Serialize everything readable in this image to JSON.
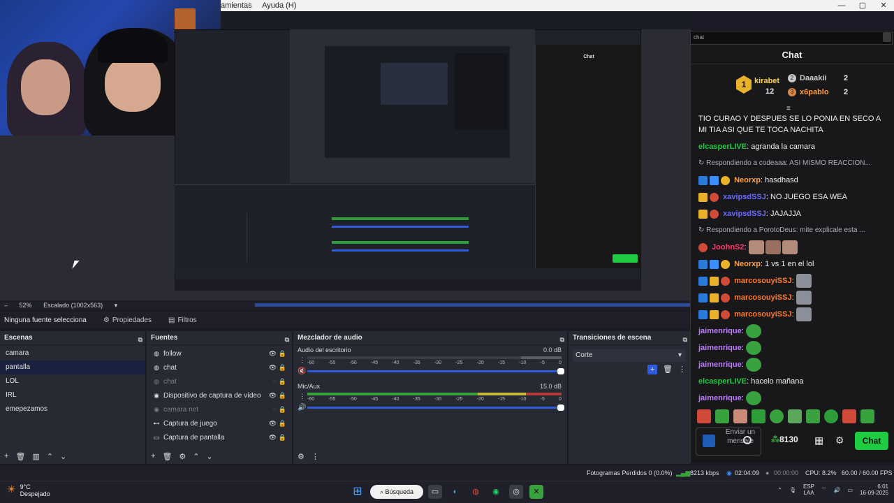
{
  "app": {
    "menu": [
      "amientas",
      "Ayuda (H)"
    ],
    "window_controls": [
      "—",
      "▢",
      "✕"
    ]
  },
  "preview": {
    "zoom": "52%",
    "scale": "Escalado (1002x563)"
  },
  "source_bar": {
    "selected_text": "Ninguna fuente selecciona",
    "properties_label": "Propiedades",
    "filters_label": "Filtros"
  },
  "scenes": {
    "title": "Escenas",
    "items": [
      "camara",
      "pantalla",
      "LOL",
      "IRL",
      "emepezamos"
    ],
    "selected_index": 1
  },
  "sources": {
    "title": "Fuentes",
    "items": [
      {
        "name": "follow",
        "visible": true
      },
      {
        "name": "chat",
        "visible": true
      },
      {
        "name": "chat",
        "visible": false
      },
      {
        "name": "Dispositivo de captura de vídeo",
        "visible": true
      },
      {
        "name": "camara net",
        "visible": false
      },
      {
        "name": "Captura de juego",
        "visible": true
      },
      {
        "name": "Captura de pantalla",
        "visible": true
      }
    ]
  },
  "mixer": {
    "title": "Mezclador de audio",
    "ticks": [
      "-60",
      "-55",
      "-50",
      "-45",
      "-40",
      "-35",
      "-30",
      "-25",
      "-20",
      "-15",
      "-10",
      "-5",
      "0"
    ],
    "channels": [
      {
        "name": "Audio del escritorio",
        "db": "0.0 dB",
        "muted": true
      },
      {
        "name": "Mic/Aux",
        "db": "15.0 dB",
        "muted": false
      }
    ]
  },
  "transitions": {
    "title": "Transiciones de escena",
    "selected": "Corte"
  },
  "status": {
    "dropped": "Fotogramas Perdidos 0 (0.0%)",
    "bitrate": "8213 kbps",
    "stream_time": "02:04:09",
    "rec_time": "00:00:00",
    "cpu": "CPU: 8.2%",
    "fps": "60.00 / 60.00 FPS"
  },
  "taskbar": {
    "temp": "9°C",
    "weather": "Despejado",
    "search": "Búsqueda",
    "lang1": "ESP",
    "lang2": "LAA",
    "time": "6:01",
    "date": "16-09-2025"
  },
  "chat": {
    "url": "chat",
    "title": "Chat",
    "leaderboard": [
      {
        "rank": "1",
        "name": "kirabet",
        "points": "12"
      },
      {
        "rank": "2",
        "name": "Daaakii",
        "points": "2"
      },
      {
        "rank": "3",
        "name": "x6pablo",
        "points": "2"
      }
    ],
    "messages": [
      {
        "user": "",
        "text": "TIO CURAO Y DESPUES SE LO PONIA EN SECO A MI TIA ASI QUE TE TOCA NACHITA",
        "color": "#efeff1"
      },
      {
        "user": "elcasperLIVE",
        "text": "agranda la camara",
        "color": "#1fcc3f"
      },
      {
        "reply": "Respondiendo a codeaaa: ASI MISMO REACCION..."
      },
      {
        "user": "Neorxp",
        "text": "hasdhasd",
        "color": "#a970ff"
      },
      {
        "user": "xavipsdSSJ",
        "text": "NO JUEGO ESA WEA",
        "color": "#6a6aff"
      },
      {
        "user": "xavipsdSSJ",
        "text": "JAJAJJA",
        "color": "#6a6aff"
      },
      {
        "reply": "Respondiendo a PorotoDeus: mite explicale esta ..."
      },
      {
        "user": "JoohnS2",
        "text": "",
        "color": "#ff3b6b"
      },
      {
        "user": "Neorxp",
        "text": "1 vs 1 en el lol",
        "color": "#a970ff"
      },
      {
        "user": "marcosouyiSSJ",
        "text": "",
        "color": "#ff7a2e"
      },
      {
        "user": "marcosouyiSSJ",
        "text": "",
        "color": "#ff7a2e"
      },
      {
        "user": "marcosouyiSSJ",
        "text": "",
        "color": "#ff7a2e"
      },
      {
        "user": "jaimenrique",
        "text": "",
        "color": "#bf7dff"
      },
      {
        "user": "jaimenrique",
        "text": "",
        "color": "#bf7dff"
      },
      {
        "user": "jaimenrique",
        "text": "",
        "color": "#bf7dff"
      },
      {
        "user": "elcasperLIVE",
        "text": "hacelo mañana",
        "color": "#1fcc3f"
      },
      {
        "user": "jaimenrique",
        "text": "",
        "color": "#bf7dff"
      }
    ],
    "input_placeholder": "Enviar un mensaje",
    "points": "8130",
    "send_label": "Chat"
  },
  "colors": {
    "obs_bg": "#272a33",
    "accent": "#2f5cdc",
    "chat_bg": "#18181b",
    "chat_btn": "#1fcc3f"
  }
}
